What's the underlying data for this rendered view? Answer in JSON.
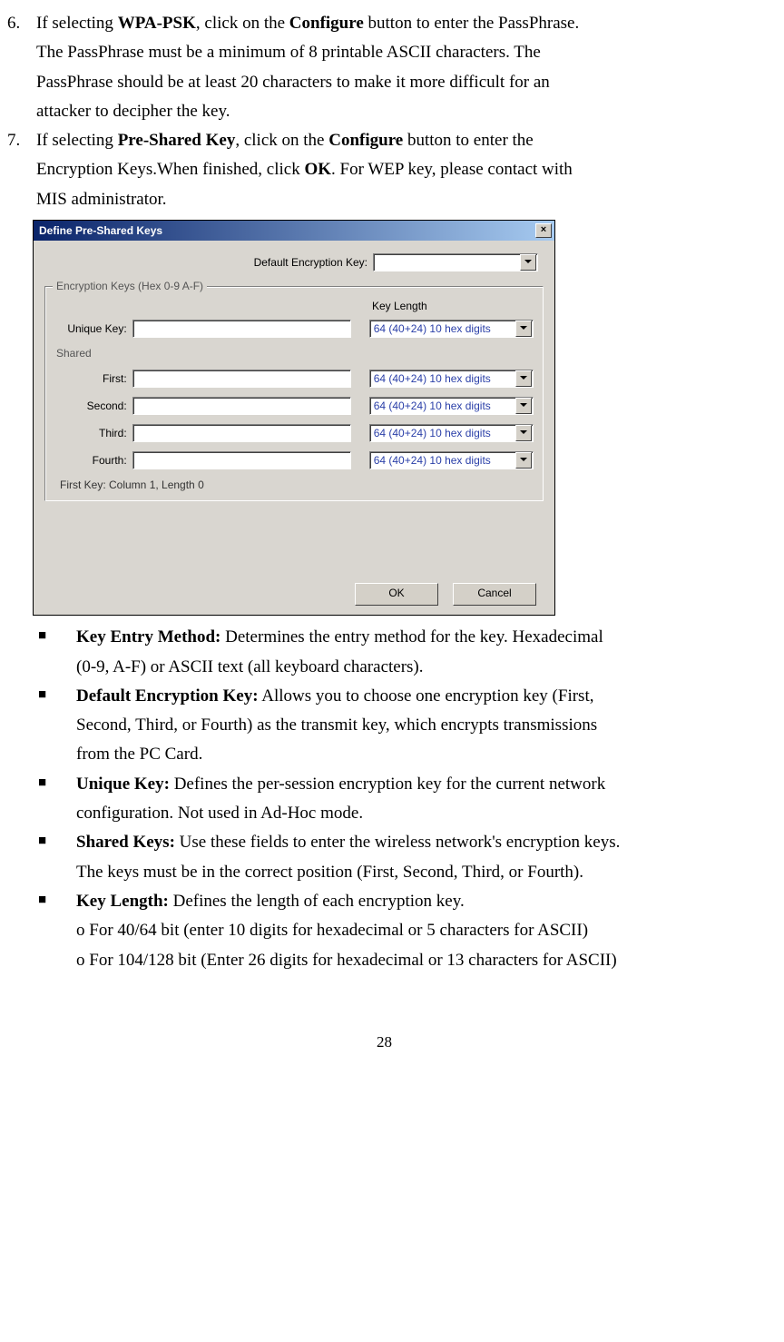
{
  "list": {
    "item6": {
      "num": "6.",
      "p1a": "If selecting ",
      "p1b": "WPA-PSK",
      "p1c": ", click on the ",
      "p1d": "Configure",
      "p1e": " button to enter the PassPhrase.",
      "p2": "The PassPhrase must be a minimum of 8 printable ASCII characters. The",
      "p3": "PassPhrase   should be at least 20 characters to make it more difficult for an",
      "p4": "attacker to decipher the key."
    },
    "item7": {
      "num": "7.",
      "p1a": "If selecting ",
      "p1b": "Pre-Shared Key",
      "p1c": ", click on the ",
      "p1d": "Configure",
      "p1e": " button to enter the",
      "p2a": "Encryption Keys.When finished, click ",
      "p2b": "OK",
      "p2c": ". For WEP key, please contact with",
      "p3": "MIS administrator."
    }
  },
  "dialog": {
    "title": "Define Pre-Shared Keys",
    "default_label": "Default Encryption Key:",
    "group_legend": "Encryption Keys (Hex 0-9 A-F)",
    "keylen_header": "Key Length",
    "unique_label": "Unique Key:",
    "shared_label": "Shared",
    "first_label": "First:",
    "second_label": "Second:",
    "third_label": "Third:",
    "fourth_label": "Fourth:",
    "combo_value": "64  (40+24)  10 hex digits",
    "status": "First Key: Column 1,  Length 0",
    "ok": "OK",
    "cancel": "Cancel"
  },
  "bullets": {
    "b1": {
      "t": "Key Entry Method:",
      "r1": " Determines the entry method for the key. Hexadecimal",
      "r2": "(0-9, A-F) or ASCII text (all keyboard characters)."
    },
    "b2": {
      "t": "Default Encryption Key:",
      "r1": " Allows you to choose one encryption key (First,",
      "r2": "Second, Third, or Fourth) as the transmit key, which encrypts transmissions",
      "r3": "from the PC Card."
    },
    "b3": {
      "t": "Unique Key:",
      "r1": " Defines the per-session encryption key for the current network",
      "r2": "configuration. Not used in Ad-Hoc mode."
    },
    "b4": {
      "t": "Shared Keys:",
      "r1": " Use these fields to enter the wireless network's encryption keys.",
      "r2": "The keys must be in the correct position (First, Second, Third, or Fourth)."
    },
    "b5": {
      "t": "Key Length:",
      "r1": " Defines the length of each encryption key.",
      "s1": "o For 40/64 bit (enter 10 digits for hexadecimal or 5 characters for ASCII)",
      "s2": "o For 104/128 bit (Enter 26 digits for hexadecimal or 13 characters for ASCII)"
    }
  },
  "pagenum": "28"
}
